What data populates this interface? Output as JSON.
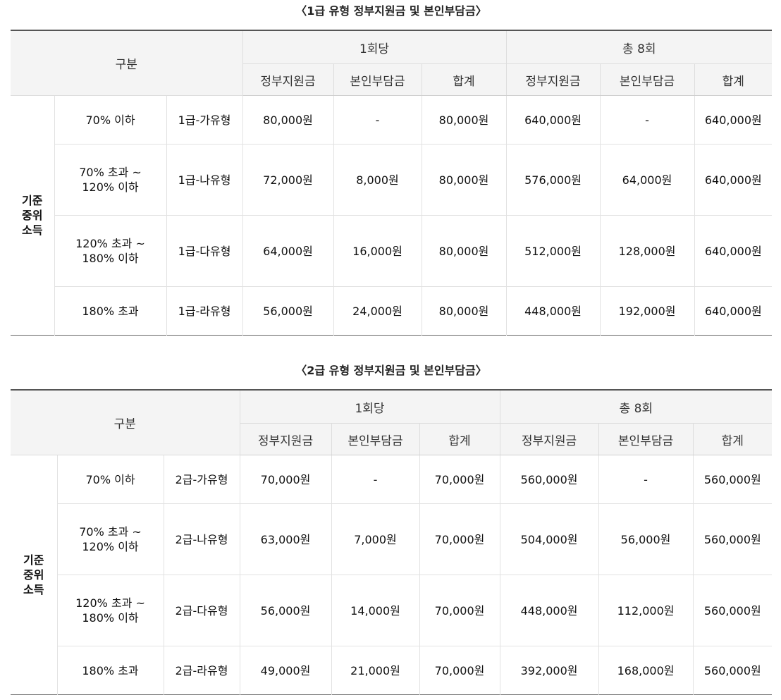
{
  "tables": [
    {
      "title": "〈1급 유형 정부지원금 및 본인부담금〉",
      "category_header": "구분",
      "group_headers": [
        "1회당",
        "총 8회"
      ],
      "sub_headers": [
        "정부지원금",
        "본인부담금",
        "합계",
        "정부지원금",
        "본인부담금",
        "합계"
      ],
      "group_label": "기준\n중위\n소득",
      "rows": [
        {
          "range": "70% 이하",
          "type": "1급-가유형",
          "cells": [
            "80,000원",
            "-",
            "80,000원",
            "640,000원",
            "-",
            "640,000원"
          ]
        },
        {
          "range": "70% 초과 ~\n120% 이하",
          "type": "1급-나유형",
          "cells": [
            "72,000원",
            "8,000원",
            "80,000원",
            "576,000원",
            "64,000원",
            "640,000원"
          ]
        },
        {
          "range": "120% 초과 ~\n180% 이하",
          "type": "1급-다유형",
          "cells": [
            "64,000원",
            "16,000원",
            "80,000원",
            "512,000원",
            "128,000원",
            "640,000원"
          ]
        },
        {
          "range": "180% 초과",
          "type": "1급-라유형",
          "cells": [
            "56,000원",
            "24,000원",
            "80,000원",
            "448,000원",
            "192,000원",
            "640,000원"
          ]
        }
      ]
    },
    {
      "title": "〈2급 유형 정부지원금 및 본인부담금〉",
      "category_header": "구분",
      "group_headers": [
        "1회당",
        "총 8회"
      ],
      "sub_headers": [
        "정부지원금",
        "본인부담금",
        "합계",
        "정부지원금",
        "본인부담금",
        "합계"
      ],
      "group_label": "기준\n중위\n소득",
      "rows": [
        {
          "range": "70% 이하",
          "type": "2급-가유형",
          "cells": [
            "70,000원",
            "-",
            "70,000원",
            "560,000원",
            "-",
            "560,000원"
          ]
        },
        {
          "range": "70% 초과 ~\n120% 이하",
          "type": "2급-나유형",
          "cells": [
            "63,000원",
            "7,000원",
            "70,000원",
            "504,000원",
            "56,000원",
            "560,000원"
          ]
        },
        {
          "range": "120% 초과 ~\n180% 이하",
          "type": "2급-다유형",
          "cells": [
            "56,000원",
            "14,000원",
            "70,000원",
            "448,000원",
            "112,000원",
            "560,000원"
          ]
        },
        {
          "range": "180% 초과",
          "type": "2급-라유형",
          "cells": [
            "49,000원",
            "21,000원",
            "70,000원",
            "392,000원",
            "168,000원",
            "560,000원"
          ]
        }
      ]
    }
  ]
}
